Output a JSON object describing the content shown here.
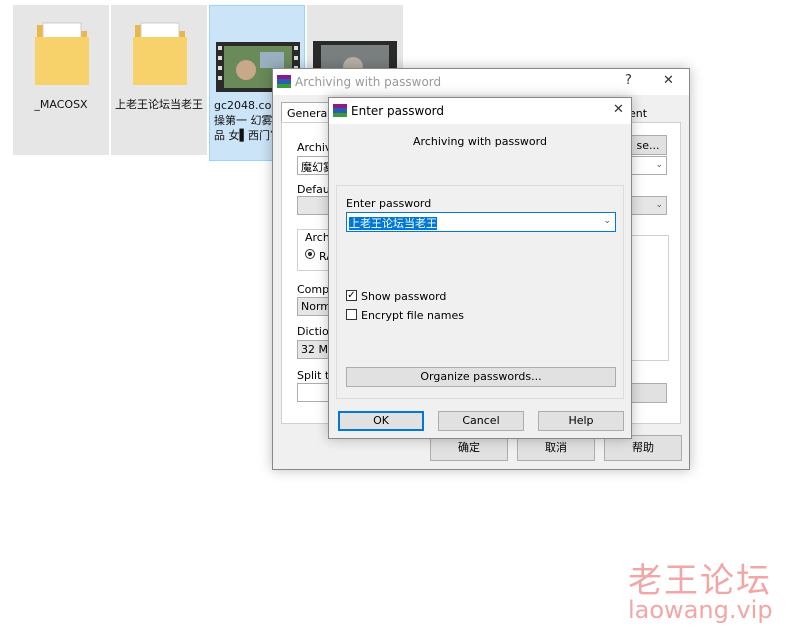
{
  "desktop": {
    "icons": [
      {
        "label": "_MACOSX"
      },
      {
        "label": "上老王论坛当老王"
      },
      {
        "label": "gc2048.co 国巡操第一 幻雾都极品 女▌西门官"
      },
      {
        "label": ""
      }
    ]
  },
  "back_dialog": {
    "title": "Archiving with password",
    "help_btn": "?",
    "close_btn": "✕",
    "tab_general": "General",
    "tab_comment": "ent",
    "archive_label": "Archive",
    "archive_value": "魔幻雾",
    "browse_label": "se...",
    "default_label": "Default",
    "archive_format_label": "Archiv",
    "rar_label": "RA",
    "compression_label": "Compre",
    "compression_value": "Norma",
    "dictionary_label": "Dictiona",
    "dictionary_value": "32 MB",
    "split_label": "Split to",
    "ok": "确定",
    "cancel": "取消",
    "help": "帮助"
  },
  "pw_dialog": {
    "title": "Enter password",
    "close_btn": "✕",
    "header": "Archiving with password",
    "enter_password_label": "Enter password",
    "password_value": "上老王论坛当老王",
    "show_password_label": "Show password",
    "show_password_checked": true,
    "encrypt_names_label": "Encrypt file names",
    "encrypt_names_checked": false,
    "organize_label": "Organize passwords...",
    "ok": "OK",
    "cancel": "Cancel",
    "help": "Help"
  },
  "watermark": {
    "text": "老王论坛",
    "url": "laowang.vip"
  }
}
